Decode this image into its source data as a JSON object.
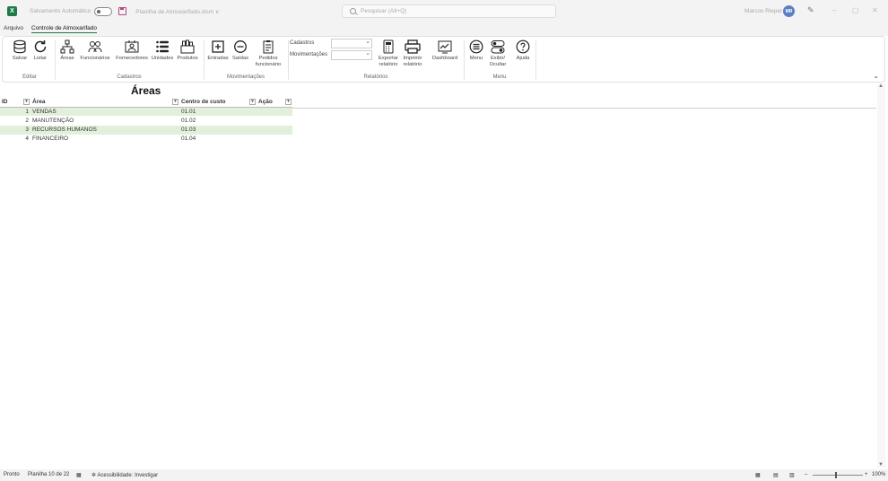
{
  "titlebar": {
    "app_logo": "X",
    "autosave_label": "Salvamento Automático",
    "file_name": "Planilha de Almoxarifado.xlsm ∨",
    "search_placeholder": "Pesquisar (Alt+Q)",
    "user_name": "Marcos Rieper",
    "user_initials": "MR",
    "minimize": "–",
    "restore": "▢",
    "close": "✕"
  },
  "menu": {
    "tabs": [
      {
        "label": "Arquivo"
      },
      {
        "label": "Controle de Almoxarifado"
      }
    ]
  },
  "ribbon": {
    "editar": {
      "label": "Editar",
      "buttons": [
        "Salvar",
        "Listar"
      ]
    },
    "cadastros": {
      "label": "Cadastros",
      "buttons": [
        "Áreas",
        "Funcionários",
        "Fornecedores",
        "Unidades",
        "Produtos"
      ]
    },
    "movimentacoes": {
      "label": "Movimentações",
      "buttons": [
        "Entradas",
        "Saídas",
        "Pedidos",
        "funcionário"
      ]
    },
    "relatorios": {
      "label": "Relatórios",
      "combo1_label": "Cadastros",
      "combo2_label": "Movimentações",
      "buttons": [
        "Exportar",
        "relatório",
        "Imprimir",
        "relatório",
        "Dashboard"
      ]
    },
    "menu": {
      "label": "Menu",
      "buttons": [
        "Menu",
        "Exibir/",
        "Ocultar",
        "Ajuda"
      ]
    }
  },
  "sheet": {
    "title": "Áreas",
    "headers": [
      "ID",
      "Área",
      "Centro de custo",
      "Ação"
    ],
    "rows": [
      {
        "id": "1",
        "area": "VENDAS",
        "cc": "01.01"
      },
      {
        "id": "2",
        "area": "MANUTENÇÃO",
        "cc": "01.02"
      },
      {
        "id": "3",
        "area": "RECURSOS HUMANOS",
        "cc": "01.03"
      },
      {
        "id": "4",
        "area": "FINANCEIRO",
        "cc": "01.04"
      }
    ]
  },
  "status": {
    "mode": "Pronto",
    "sheet_count": "Planilha 10 de 22",
    "accessibility": "Acessibilidade: Investigar",
    "zoom": "100%"
  },
  "colors": {
    "accent": "#1f7a45",
    "band": "#e2efda"
  }
}
